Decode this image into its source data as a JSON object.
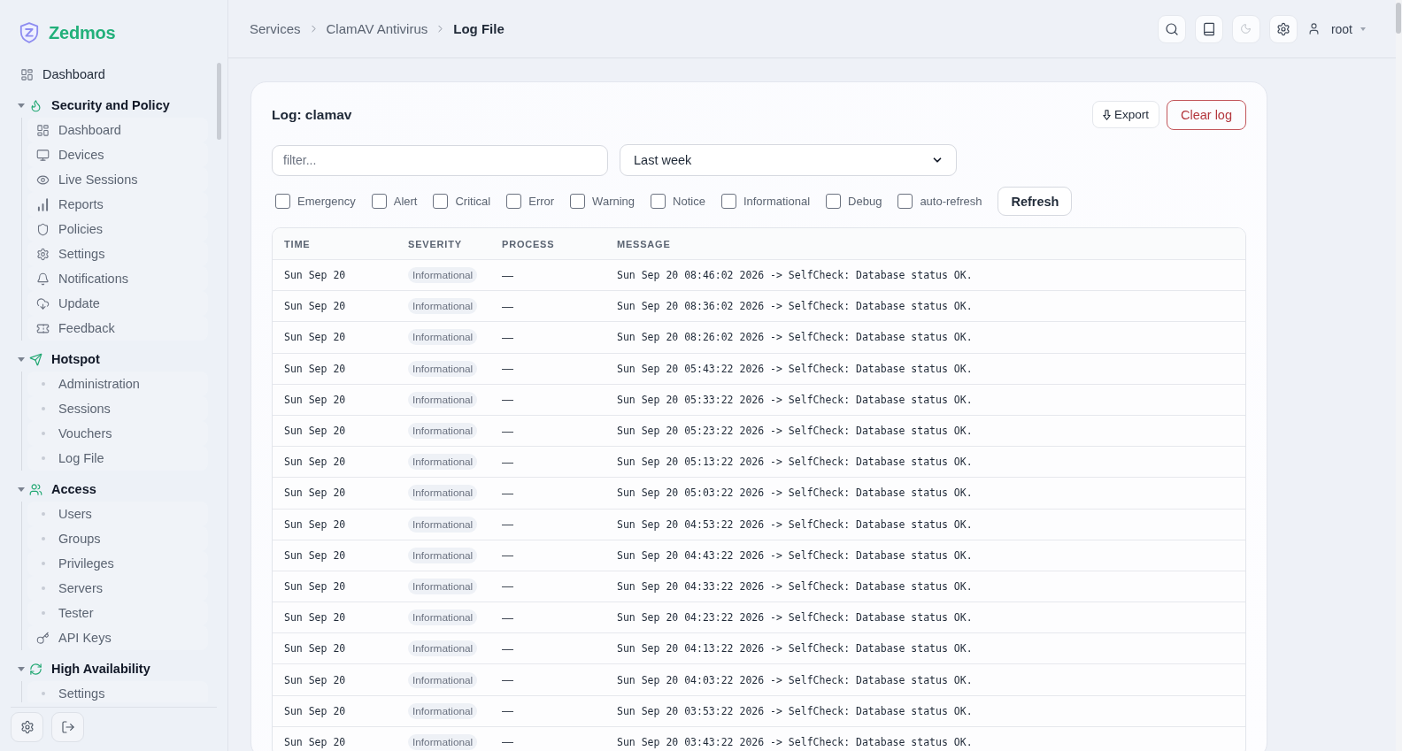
{
  "sidebar": {
    "brand": "Zedmos",
    "nav": [
      {
        "kind": "link",
        "label": "Dashboard",
        "selected": false
      },
      {
        "kind": "section",
        "label": "Security and Policy",
        "expanded": true,
        "children": [
          {
            "label": "Dashboard",
            "selected": false
          },
          {
            "label": "Devices",
            "selected": false
          },
          {
            "label": "Live Sessions",
            "selected": false
          },
          {
            "label": "Reports",
            "selected": false
          },
          {
            "label": "Policies",
            "selected": false
          },
          {
            "label": "Settings",
            "selected": false
          },
          {
            "label": "Notifications",
            "selected": false
          },
          {
            "label": "Update",
            "selected": false
          },
          {
            "label": "Feedback",
            "selected": false
          }
        ]
      },
      {
        "kind": "section",
        "label": "Hotspot",
        "expanded": true,
        "children": [
          {
            "label": "Administration",
            "selected": false
          },
          {
            "label": "Sessions",
            "selected": false
          },
          {
            "label": "Vouchers",
            "selected": false
          },
          {
            "label": "Log File",
            "selected": false
          }
        ]
      },
      {
        "kind": "section",
        "label": "Access",
        "expanded": true,
        "children": [
          {
            "label": "Users",
            "selected": false
          },
          {
            "label": "Groups",
            "selected": false
          },
          {
            "label": "Privileges",
            "selected": false
          },
          {
            "label": "Servers",
            "selected": false
          },
          {
            "label": "Tester",
            "selected": false
          },
          {
            "label": "API Keys",
            "selected": false
          }
        ]
      },
      {
        "kind": "section",
        "label": "High Availability",
        "expanded": true,
        "children": [
          {
            "label": "Settings",
            "selected": false
          }
        ]
      }
    ]
  },
  "header": {
    "breadcrumb": [
      "Services",
      "ClamAV Antivirus",
      "Log File"
    ],
    "user": "root"
  },
  "log": {
    "title": "Log: clamav",
    "actions": [
      {
        "kind": "export",
        "label": "Export"
      },
      {
        "kind": "danger",
        "label": "Clear log"
      }
    ],
    "filter": {
      "placeholder": "filter..."
    },
    "range": {
      "value": "Last week"
    },
    "levels": [
      {
        "label": "Emergency",
        "checked": false
      },
      {
        "label": "Alert",
        "checked": false
      },
      {
        "label": "Critical",
        "checked": false
      },
      {
        "label": "Error",
        "checked": false
      },
      {
        "label": "Warning",
        "checked": false
      },
      {
        "label": "Notice",
        "checked": false
      },
      {
        "label": "Informational",
        "checked": false
      },
      {
        "label": "Debug",
        "checked": false
      }
    ],
    "auto_refresh": {
      "label": "auto-refresh",
      "checked": false
    },
    "refresh": "Refresh",
    "table": {
      "columns": [
        "TIME",
        "SEVERITY",
        "PROCESS",
        "MESSAGE"
      ],
      "rows": [
        {
          "time": "Sun Sep 20",
          "severity": "Informational",
          "process": "—",
          "message": "Sun Sep 20 08:46:02 2026 -> SelfCheck: Database status OK."
        },
        {
          "time": "Sun Sep 20",
          "severity": "Informational",
          "process": "—",
          "message": "Sun Sep 20 08:36:02 2026 -> SelfCheck: Database status OK."
        },
        {
          "time": "Sun Sep 20",
          "severity": "Informational",
          "process": "—",
          "message": "Sun Sep 20 08:26:02 2026 -> SelfCheck: Database status OK."
        },
        {
          "time": "Sun Sep 20",
          "severity": "Informational",
          "process": "—",
          "message": "Sun Sep 20 05:43:22 2026 -> SelfCheck: Database status OK."
        },
        {
          "time": "Sun Sep 20",
          "severity": "Informational",
          "process": "—",
          "message": "Sun Sep 20 05:33:22 2026 -> SelfCheck: Database status OK."
        },
        {
          "time": "Sun Sep 20",
          "severity": "Informational",
          "process": "—",
          "message": "Sun Sep 20 05:23:22 2026 -> SelfCheck: Database status OK."
        },
        {
          "time": "Sun Sep 20",
          "severity": "Informational",
          "process": "—",
          "message": "Sun Sep 20 05:13:22 2026 -> SelfCheck: Database status OK."
        },
        {
          "time": "Sun Sep 20",
          "severity": "Informational",
          "process": "—",
          "message": "Sun Sep 20 05:03:22 2026 -> SelfCheck: Database status OK."
        },
        {
          "time": "Sun Sep 20",
          "severity": "Informational",
          "process": "—",
          "message": "Sun Sep 20 04:53:22 2026 -> SelfCheck: Database status OK."
        },
        {
          "time": "Sun Sep 20",
          "severity": "Informational",
          "process": "—",
          "message": "Sun Sep 20 04:43:22 2026 -> SelfCheck: Database status OK."
        },
        {
          "time": "Sun Sep 20",
          "severity": "Informational",
          "process": "—",
          "message": "Sun Sep 20 04:33:22 2026 -> SelfCheck: Database status OK."
        },
        {
          "time": "Sun Sep 20",
          "severity": "Informational",
          "process": "—",
          "message": "Sun Sep 20 04:23:22 2026 -> SelfCheck: Database status OK."
        },
        {
          "time": "Sun Sep 20",
          "severity": "Informational",
          "process": "—",
          "message": "Sun Sep 20 04:13:22 2026 -> SelfCheck: Database status OK."
        },
        {
          "time": "Sun Sep 20",
          "severity": "Informational",
          "process": "—",
          "message": "Sun Sep 20 04:03:22 2026 -> SelfCheck: Database status OK."
        },
        {
          "time": "Sun Sep 20",
          "severity": "Informational",
          "process": "—",
          "message": "Sun Sep 20 03:53:22 2026 -> SelfCheck: Database status OK."
        },
        {
          "time": "Sun Sep 20",
          "severity": "Informational",
          "process": "—",
          "message": "Sun Sep 20 03:43:22 2026 -> SelfCheck: Database status OK."
        }
      ]
    }
  }
}
